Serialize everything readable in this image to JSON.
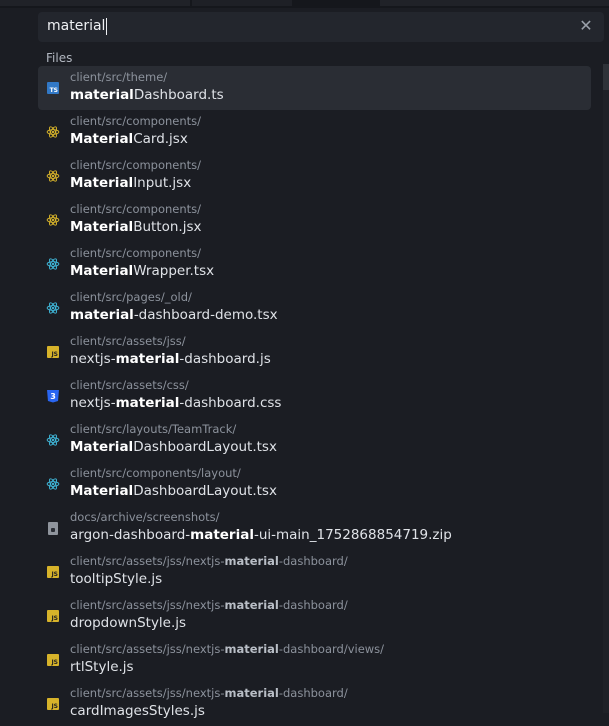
{
  "search": {
    "value": "material"
  },
  "section_label": "Files",
  "colors": {
    "ts": "#3178c6",
    "js": "#d7b32a",
    "react_jsx": "#d7b32a",
    "react_tsx": "#3fb6d8",
    "css": "#2965f1",
    "zip": "#8f949c"
  },
  "files": [
    {
      "icon": "ts-icon",
      "path": [
        "client/src/theme/"
      ],
      "name": [
        "",
        "material",
        "Dashboard.ts"
      ]
    },
    {
      "icon": "react-jsx-icon",
      "path": [
        "client/src/components/"
      ],
      "name": [
        "",
        "Material",
        "Card.jsx"
      ]
    },
    {
      "icon": "react-jsx-icon",
      "path": [
        "client/src/components/"
      ],
      "name": [
        "",
        "Material",
        "Input.jsx"
      ]
    },
    {
      "icon": "react-jsx-icon",
      "path": [
        "client/src/components/"
      ],
      "name": [
        "",
        "Material",
        "Button.jsx"
      ]
    },
    {
      "icon": "react-tsx-icon",
      "path": [
        "client/src/components/"
      ],
      "name": [
        "",
        "Material",
        "Wrapper.tsx"
      ]
    },
    {
      "icon": "react-tsx-icon",
      "path": [
        "client/src/pages/_old/"
      ],
      "name": [
        "",
        "material",
        "-dashboard-demo.tsx"
      ]
    },
    {
      "icon": "js-icon",
      "path": [
        "client/src/assets/jss/"
      ],
      "name": [
        "nextjs-",
        "material",
        "-dashboard.js"
      ]
    },
    {
      "icon": "css-icon",
      "path": [
        "client/src/assets/css/"
      ],
      "name": [
        "nextjs-",
        "material",
        "-dashboard.css"
      ]
    },
    {
      "icon": "react-tsx-icon",
      "path": [
        "client/src/layouts/TeamTrack/"
      ],
      "name": [
        "",
        "Material",
        "DashboardLayout.tsx"
      ]
    },
    {
      "icon": "react-tsx-icon",
      "path": [
        "client/src/components/layout/"
      ],
      "name": [
        "",
        "Material",
        "DashboardLayout.tsx"
      ]
    },
    {
      "icon": "zip-icon",
      "path": [
        "docs/archive/screenshots/"
      ],
      "name": [
        "argon-dashboard-",
        "material",
        "-ui-main_1752868854719.zip"
      ]
    },
    {
      "icon": "js-icon",
      "path": [
        "client/src/assets/jss/nextjs-",
        "material",
        "-dashboard/"
      ],
      "name": [
        "tooltipStyle.js"
      ]
    },
    {
      "icon": "js-icon",
      "path": [
        "client/src/assets/jss/nextjs-",
        "material",
        "-dashboard/"
      ],
      "name": [
        "dropdownStyle.js"
      ]
    },
    {
      "icon": "js-icon",
      "path": [
        "client/src/assets/jss/nextjs-",
        "material",
        "-dashboard/views/"
      ],
      "name": [
        "rtlStyle.js"
      ]
    },
    {
      "icon": "js-icon",
      "path": [
        "client/src/assets/jss/nextjs-",
        "material",
        "-dashboard/"
      ],
      "name": [
        "cardImagesStyles.js"
      ]
    }
  ]
}
